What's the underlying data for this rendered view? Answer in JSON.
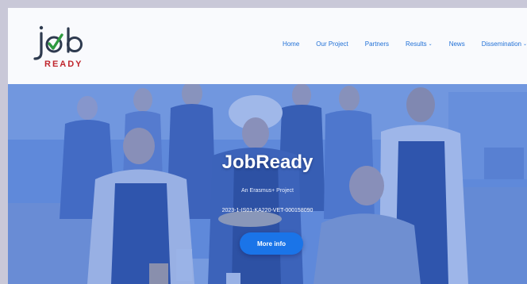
{
  "brand": {
    "logo_top": "job",
    "logo_bottom": "READY",
    "colors": {
      "navy": "#2e3a4f",
      "red": "#c0262d",
      "green": "#2e9a3f"
    }
  },
  "nav": {
    "items": [
      {
        "label": "Home"
      },
      {
        "label": "Our Project"
      },
      {
        "label": "Partners"
      },
      {
        "label": "Results",
        "chevron": "⌄"
      },
      {
        "label": "News"
      },
      {
        "label": "Dissemination",
        "chevron": "⌄"
      }
    ],
    "color": "#1f6fd6"
  },
  "hero": {
    "title": "JobReady",
    "subtitle": "An Erasmus+ Project",
    "project_code": "2023-1-IS01-KA220-VET-000158090",
    "cta_label": "More info",
    "cta_color": "#1a74e8",
    "overlay_color": "#3c6ed2"
  }
}
